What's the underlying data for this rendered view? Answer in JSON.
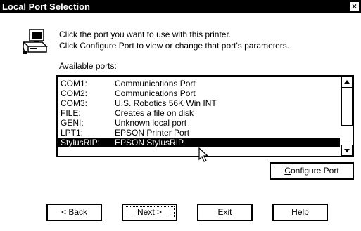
{
  "window": {
    "title": "Local Port Selection",
    "close_glyph": "×"
  },
  "icons": {
    "printer": "printer-icon",
    "close": "close-icon",
    "scroll_up": "arrow-up-icon",
    "scroll_down": "arrow-down-icon",
    "cursor": "mouse-pointer-icon"
  },
  "instructions": {
    "line1": "Click the port you want to use with this printer.",
    "line2": "Click Configure Port to view or change that port's parameters."
  },
  "ports_label": "Available ports:",
  "ports": [
    {
      "port": "COM1:",
      "description": "Communications Port",
      "selected": false
    },
    {
      "port": "COM2:",
      "description": "Communications Port",
      "selected": false
    },
    {
      "port": "COM3:",
      "description": "U.S. Robotics 56K Win INT",
      "selected": false
    },
    {
      "port": "FILE:",
      "description": "Creates a file on disk",
      "selected": false
    },
    {
      "port": "GENI:",
      "description": "Unknown local port",
      "selected": false
    },
    {
      "port": "LPT1:",
      "description": "EPSON Printer Port",
      "selected": false
    },
    {
      "port": "StylusRIP:",
      "description": "EPSON StylusRIP",
      "selected": true
    }
  ],
  "buttons": {
    "configure": {
      "mnemonic": "C",
      "rest": "onfigure Port"
    },
    "back": {
      "prefix": "< ",
      "mnemonic": "B",
      "rest": "ack"
    },
    "next": {
      "mnemonic": "N",
      "rest": "ext >"
    },
    "exit": {
      "mnemonic": "E",
      "rest": "xit"
    },
    "help": {
      "mnemonic": "H",
      "rest": "elp"
    }
  }
}
